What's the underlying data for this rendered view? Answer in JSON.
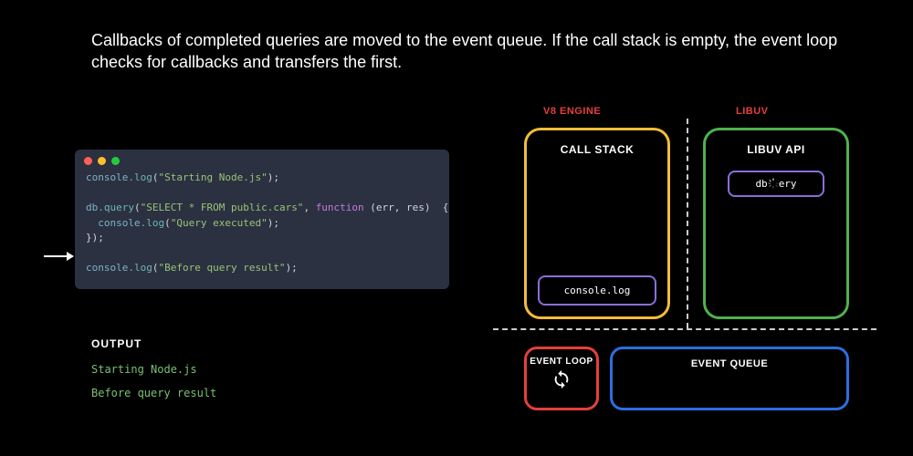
{
  "caption": "Callbacks of completed queries are moved to the event queue. If the call stack is empty, the event loop checks for callbacks and transfers the first.",
  "code": {
    "line1_obj": "console",
    "line1_call": ".log",
    "line1_open": "(",
    "line1_str": "\"Starting Node.js\"",
    "line1_close": ");",
    "line2_obj": "db",
    "line2_call": ".query",
    "line2_open": "(",
    "line2_str1": "\"SELECT * FROM public.cars\"",
    "line2_mid": ", ",
    "line2_kw": "function",
    "line2_args": " (err, res)  {",
    "line3_indent": "  ",
    "line3_obj": "console",
    "line3_call": ".log",
    "line3_open": "(",
    "line3_str": "\"Query executed\"",
    "line3_close": ");",
    "line4": "});",
    "line5_obj": "console",
    "line5_call": ".log",
    "line5_open": "(",
    "line5_str": "\"Before query result\"",
    "line5_close": ");"
  },
  "output": {
    "title": "OUTPUT",
    "lines": [
      "Starting Node.js",
      "Before query result"
    ]
  },
  "labels": {
    "v8": "V8 ENGINE",
    "libuv": "LIBUV"
  },
  "call_stack": {
    "title": "CALL STACK",
    "item": "console.log"
  },
  "libuv_box": {
    "title": "LIBUV API",
    "item_prefix": "db",
    "item_suffix": "ery"
  },
  "event_loop": {
    "title": "EVENT LOOP",
    "icon": "⟳"
  },
  "event_queue": {
    "title": "EVENT QUEUE"
  }
}
